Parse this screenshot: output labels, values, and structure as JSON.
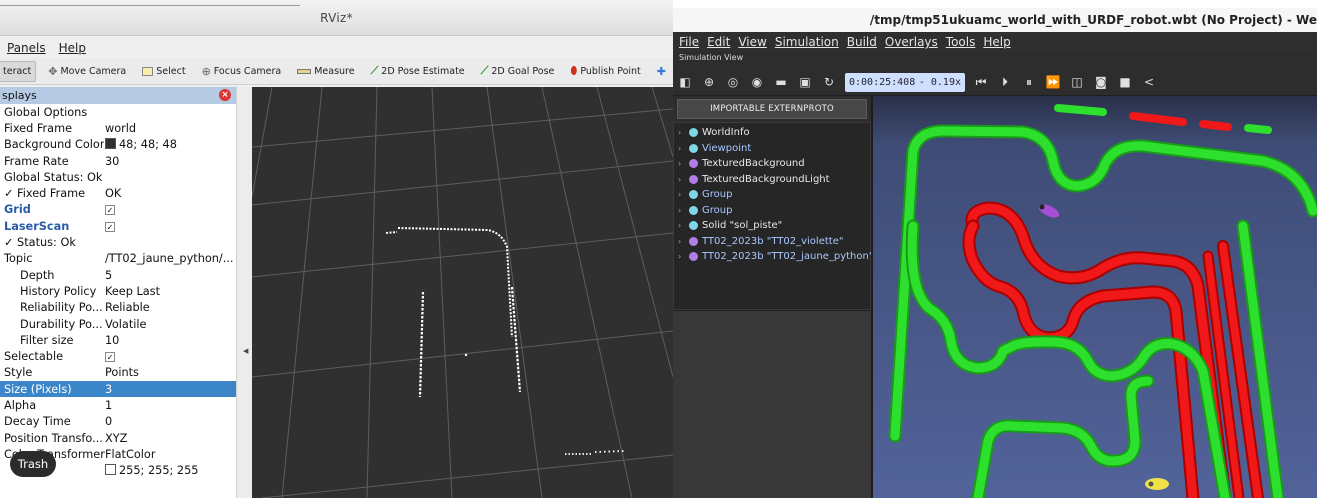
{
  "rviz": {
    "title": "RViz*",
    "menu": [
      "Panels",
      "Help"
    ],
    "toolbar": [
      {
        "label": "teract",
        "icon": "interact-icon",
        "active": true
      },
      {
        "label": "Move Camera",
        "icon": "move-camera-icon"
      },
      {
        "label": "Select",
        "icon": "select-icon"
      },
      {
        "label": "Focus Camera",
        "icon": "focus-camera-icon"
      },
      {
        "label": "Measure",
        "icon": "measure-icon"
      },
      {
        "label": "2D Pose Estimate",
        "icon": "pose-estimate-icon"
      },
      {
        "label": "2D Goal Pose",
        "icon": "goal-pose-icon"
      },
      {
        "label": "Publish Point",
        "icon": "publish-point-icon"
      }
    ],
    "displays_header": "splays",
    "trash_label": "Trash",
    "rows": [
      {
        "key": "Global Options",
        "value": ""
      },
      {
        "key": "Fixed Frame",
        "value": "world"
      },
      {
        "key": "Background Color",
        "value": "48; 48; 48"
      },
      {
        "key": "Frame Rate",
        "value": "30"
      },
      {
        "key": "Global Status: Ok",
        "value": ""
      },
      {
        "key": "✓ Fixed Frame",
        "value": "OK"
      },
      {
        "key": "Grid",
        "value": "✓"
      },
      {
        "key": "LaserScan",
        "value": "✓"
      },
      {
        "key": "✓ Status: Ok",
        "value": ""
      },
      {
        "key": "Topic",
        "value": "/TT02_jaune_python/..."
      },
      {
        "key": "Depth",
        "value": "5"
      },
      {
        "key": "History Policy",
        "value": "Keep Last"
      },
      {
        "key": "Reliability Po...",
        "value": "Reliable"
      },
      {
        "key": "Durability Po...",
        "value": "Volatile"
      },
      {
        "key": "Filter size",
        "value": "10"
      },
      {
        "key": "Selectable",
        "value": "✓"
      },
      {
        "key": "Style",
        "value": "Points"
      },
      {
        "key": "Size (Pixels)",
        "value": "3"
      },
      {
        "key": "Alpha",
        "value": "1"
      },
      {
        "key": "Decay Time",
        "value": "0"
      },
      {
        "key": "Position Transfo...",
        "value": "XYZ"
      },
      {
        "key": "Color Transformer",
        "value": "FlatColor"
      },
      {
        "key": "",
        "value": "255; 255; 255"
      }
    ]
  },
  "webots": {
    "title": "/tmp/tmp51ukuamc_world_with_URDF_robot.wbt (No Project) - We",
    "menu": [
      "File",
      "Edit",
      "View",
      "Simulation",
      "Build",
      "Overlays",
      "Tools",
      "Help"
    ],
    "simulation_view_label": "Simulation View",
    "time": "0:00:25:408",
    "speed": "- 0.19x",
    "importable_label": "IMPORTABLE EXTERNPROTO",
    "nodes": [
      {
        "label": "WorldInfo",
        "color": "#7fd7e6",
        "text_color": "#e8e8e8"
      },
      {
        "label": "Viewpoint",
        "color": "#7fd7e6",
        "text_color": "#a9c8ff"
      },
      {
        "label": "TexturedBackground",
        "color": "#b07fe6",
        "text_color": "#e8e8e8"
      },
      {
        "label": "TexturedBackgroundLight",
        "color": "#b07fe6",
        "text_color": "#e8e8e8"
      },
      {
        "label": "Group",
        "color": "#7fd7e6",
        "text_color": "#a9c8ff"
      },
      {
        "label": "Group",
        "color": "#7fd7e6",
        "text_color": "#a9c8ff"
      },
      {
        "label": "Solid \"sol_piste\"",
        "color": "#7fd7e6",
        "text_color": "#e8e8e8"
      },
      {
        "label": "TT02_2023b \"TT02_violette\"",
        "color": "#b07fe6",
        "text_color": "#a9c8ff"
      },
      {
        "label": "TT02_2023b \"TT02_jaune_python\"",
        "color": "#b07fe6",
        "text_color": "#a9c8ff"
      }
    ]
  },
  "colors": {
    "rviz_selection": "#3b86c8",
    "rviz_background": "#303030",
    "track_green": "#2ee02e",
    "track_red": "#f01818",
    "webots_floor": "#4a5a86"
  }
}
